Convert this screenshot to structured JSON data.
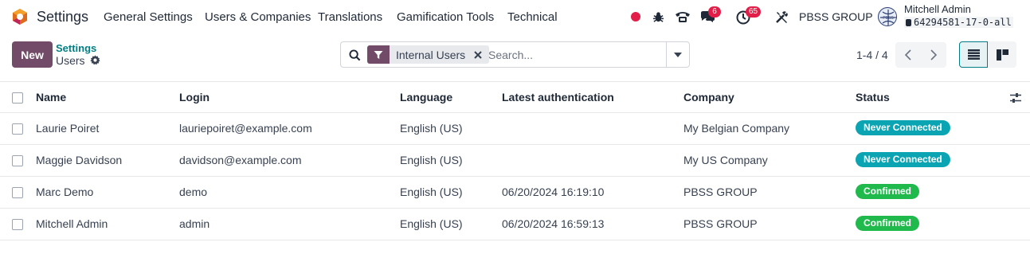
{
  "app": {
    "title": "Settings"
  },
  "menu": [
    "General Settings",
    "Users & Companies",
    "Translations",
    "Gamification Tools",
    "Technical"
  ],
  "systray": {
    "messages_count": "6",
    "activities_count": "65",
    "company": "PBSS GROUP",
    "user_name": "Mitchell Admin",
    "database": "64294581-17-0-all"
  },
  "control": {
    "new_label": "New",
    "breadcrumb_parent": "Settings",
    "breadcrumb_current": "Users",
    "facet_label": "Internal Users",
    "search_placeholder": "Search...",
    "pager": "1-4 / 4"
  },
  "table": {
    "columns": [
      "Name",
      "Login",
      "Language",
      "Latest authentication",
      "Company",
      "Status"
    ],
    "rows": [
      {
        "name": "Laurie Poiret",
        "login": "lauriepoiret@example.com",
        "language": "English (US)",
        "latest_auth": "",
        "company": "My Belgian Company",
        "status": "Never Connected",
        "status_color": "#0aa4b3"
      },
      {
        "name": "Maggie Davidson",
        "login": "davidson@example.com",
        "language": "English (US)",
        "latest_auth": "",
        "company": "My US Company",
        "status": "Never Connected",
        "status_color": "#0aa4b3"
      },
      {
        "name": "Marc Demo",
        "login": "demo",
        "language": "English (US)",
        "latest_auth": "06/20/2024 16:19:10",
        "company": "PBSS GROUP",
        "status": "Confirmed",
        "status_color": "#1fb94c"
      },
      {
        "name": "Mitchell Admin",
        "login": "admin",
        "language": "English (US)",
        "latest_auth": "06/20/2024 16:59:13",
        "company": "PBSS GROUP",
        "status": "Confirmed",
        "status_color": "#1fb94c"
      }
    ]
  },
  "colors": {
    "brand": "#714b67",
    "accent": "#017e84",
    "badge": "#e11d48"
  },
  "icons": [
    "odoo-logo-icon",
    "record-dot-icon",
    "bug-icon",
    "phone-icon",
    "chat-icon",
    "activity-clock-icon",
    "tools-icon",
    "company-logo-icon",
    "database-icon",
    "gear-icon",
    "search-icon",
    "filter-icon",
    "close-icon",
    "caret-down-icon",
    "chevron-left-icon",
    "chevron-right-icon",
    "list-view-icon",
    "kanban-view-icon",
    "optional-columns-icon"
  ]
}
